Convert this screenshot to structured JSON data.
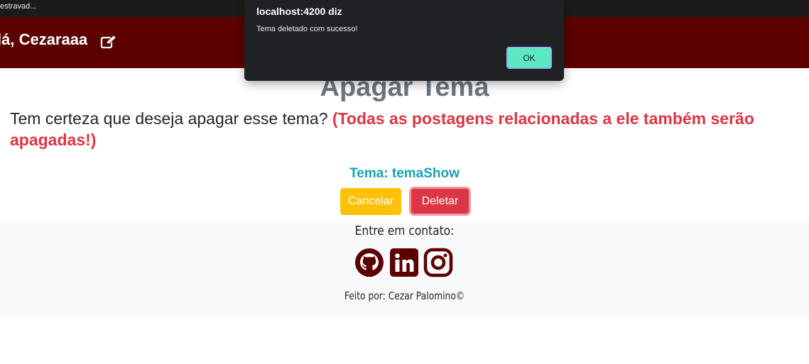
{
  "browser": {
    "tab_fragment": "estravad..."
  },
  "navbar": {
    "greeting": "lá, Cezaraaa",
    "edit_icon": "edit-icon",
    "background": "#5c0000"
  },
  "page": {
    "title": "Apagar Tema",
    "question": "Tem certeza que deseja apagar esse tema?",
    "warning": "(Todas as postagens relacionadas a ele também serão apagadas!)",
    "tema_label": "Tema: temaShow"
  },
  "actions": {
    "cancel_label": "Cancelar",
    "delete_label": "Deletar",
    "cancel_color": "#ffc107",
    "delete_color": "#dc3545"
  },
  "footer": {
    "contact_title": "Entre em contato:",
    "social_icons": [
      "github-icon",
      "linkedin-icon",
      "instagram-icon"
    ],
    "credits": "Feito por: Cezar Palomino©",
    "icon_color": "#5c0000"
  },
  "dialog": {
    "title": "localhost:4200 diz",
    "message": "Tema deletado com sucesso!",
    "ok_label": "OK",
    "ok_color": "#5ee8c2"
  }
}
